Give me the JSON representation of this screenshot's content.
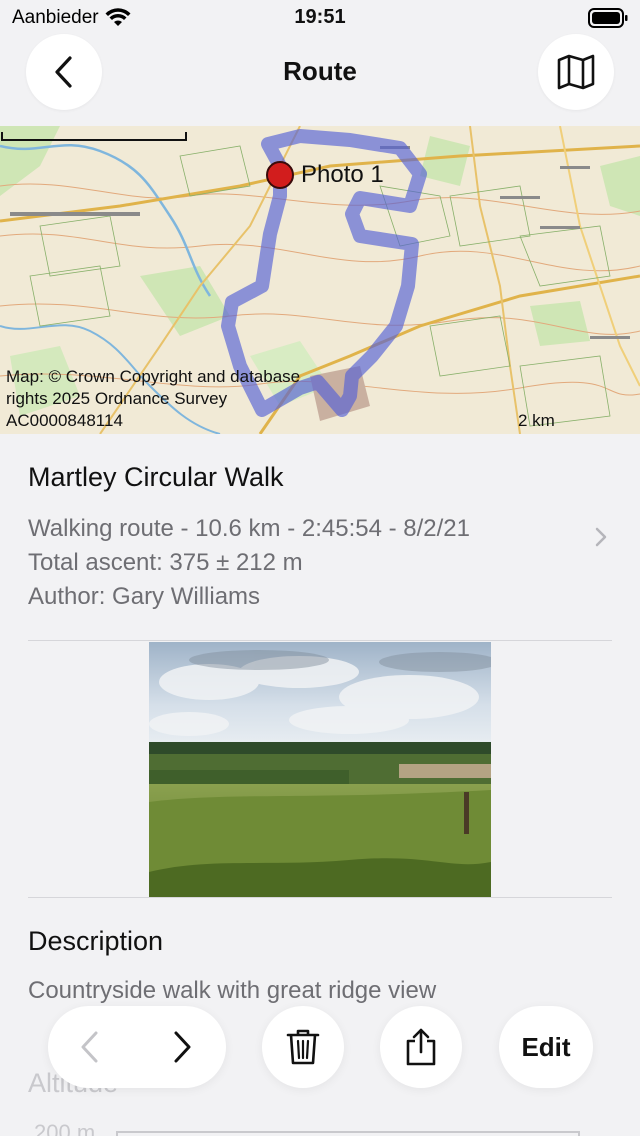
{
  "status_bar": {
    "carrier": "Aanbieder",
    "time": "19:51"
  },
  "nav": {
    "title": "Route",
    "back_icon": "chevron-left-icon",
    "map_icon": "map-icon"
  },
  "map": {
    "photo_marker_label": "Photo 1",
    "copyright": "Map: © Crown Copyright and database rights 2025 Ordnance Survey AC0000848114",
    "scale_label": "2 km",
    "route_color": "#5561d6",
    "marker_color": "#d21d1d"
  },
  "route": {
    "title": "Martley Circular Walk",
    "info_line_1": "Walking route - 10.6 km - 2:45:54 - 8/2/21",
    "info_line_2": "Total ascent: 375 ± 212 m",
    "info_line_3": "Author: Gary Williams"
  },
  "description": {
    "heading": "Description",
    "text": "Countryside walk with great ridge view"
  },
  "altitude": {
    "heading": "Altitude",
    "tick_label": "200 m"
  },
  "toolbar": {
    "prev_icon": "chevron-left-icon",
    "next_icon": "chevron-right-icon",
    "trash_icon": "trash-icon",
    "share_icon": "share-icon",
    "edit_label": "Edit"
  }
}
